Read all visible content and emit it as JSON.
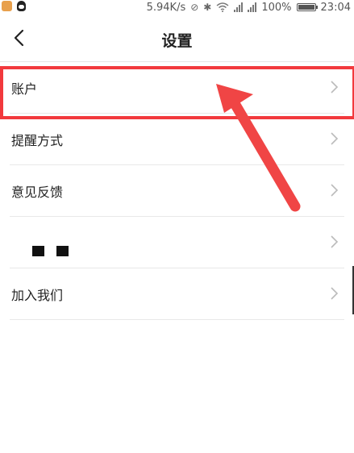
{
  "status_bar": {
    "network_speed": "5.94K/s",
    "battery_percent": "100%",
    "time": "23:04"
  },
  "header": {
    "title": "设置",
    "back_icon": "chevron-left-icon"
  },
  "menu": {
    "items": [
      {
        "label": "账户",
        "icon": "chevron-right-icon"
      },
      {
        "label": "提醒方式",
        "icon": "chevron-right-icon"
      },
      {
        "label": "意见反馈",
        "icon": "chevron-right-icon"
      },
      {
        "label": "",
        "icon": "chevron-right-icon"
      },
      {
        "label": "加入我们",
        "icon": "chevron-right-icon"
      }
    ]
  },
  "annotation": {
    "highlight_color": "#f2393d",
    "arrow_color": "#f04545"
  },
  "colors": {
    "background": "#ffffff",
    "divider": "#e8e8e8",
    "text": "#222222",
    "chevron": "#bbbbbb"
  }
}
